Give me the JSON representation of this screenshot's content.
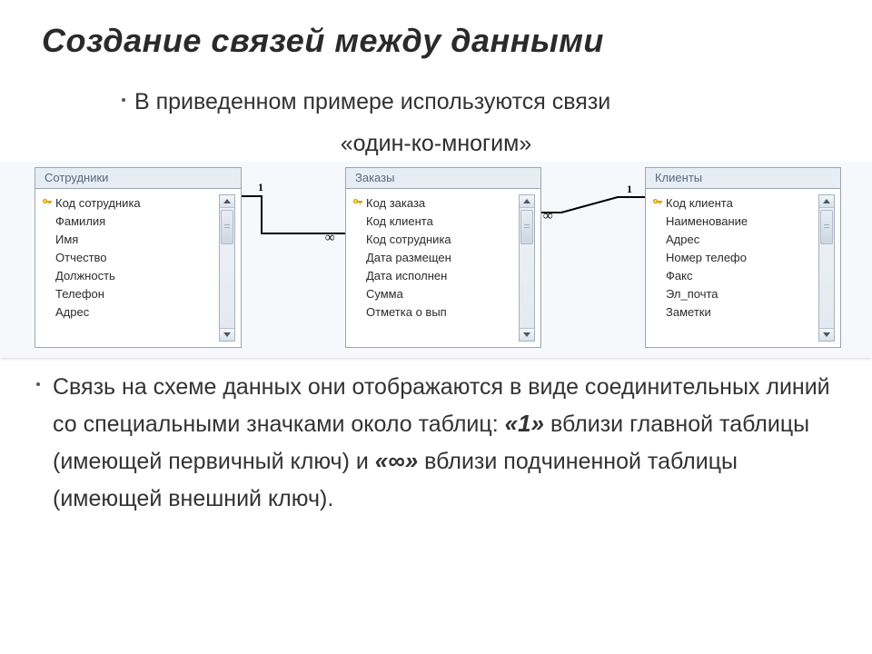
{
  "title": "Создание связей между данными",
  "intro": "В приведенном примере используются связи",
  "sub": "«один-ко-многим»",
  "tables": {
    "t1": {
      "title": "Сотрудники",
      "fields": [
        {
          "label": "Код сотрудника",
          "key": true
        },
        {
          "label": "Фамилия",
          "key": false
        },
        {
          "label": "Имя",
          "key": false
        },
        {
          "label": "Отчество",
          "key": false
        },
        {
          "label": "Должность",
          "key": false
        },
        {
          "label": "Телефон",
          "key": false
        },
        {
          "label": "Адрес",
          "key": false
        }
      ]
    },
    "t2": {
      "title": "Заказы",
      "fields": [
        {
          "label": "Код заказа",
          "key": true
        },
        {
          "label": "Код клиента",
          "key": false
        },
        {
          "label": "Код сотрудника",
          "key": false
        },
        {
          "label": "Дата размещен",
          "key": false
        },
        {
          "label": "Дата исполнен",
          "key": false
        },
        {
          "label": "Сумма",
          "key": false
        },
        {
          "label": "Отметка о вып",
          "key": false
        }
      ]
    },
    "t3": {
      "title": "Клиенты",
      "fields": [
        {
          "label": "Код клиента",
          "key": true
        },
        {
          "label": "Наименование",
          "key": false
        },
        {
          "label": "Адрес",
          "key": false
        },
        {
          "label": "Номер телефо",
          "key": false
        },
        {
          "label": "Факс",
          "key": false
        },
        {
          "label": "Эл_почта",
          "key": false
        },
        {
          "label": "Заметки",
          "key": false
        }
      ]
    }
  },
  "relations": {
    "r1": {
      "one": "1",
      "many": "∞"
    },
    "r2": {
      "one": "1",
      "many": "∞"
    }
  },
  "para": {
    "p1": "Связь на схеме данных они отображаются в виде соединительных линий со специальными значками около таблиц: ",
    "one": "«1»",
    "p2": " вблизи главной таблицы (имеющей первичный ключ) и ",
    "inf": "«∞»",
    "p3": " вблизи подчиненной таблицы (имеющей внешний ключ)."
  }
}
